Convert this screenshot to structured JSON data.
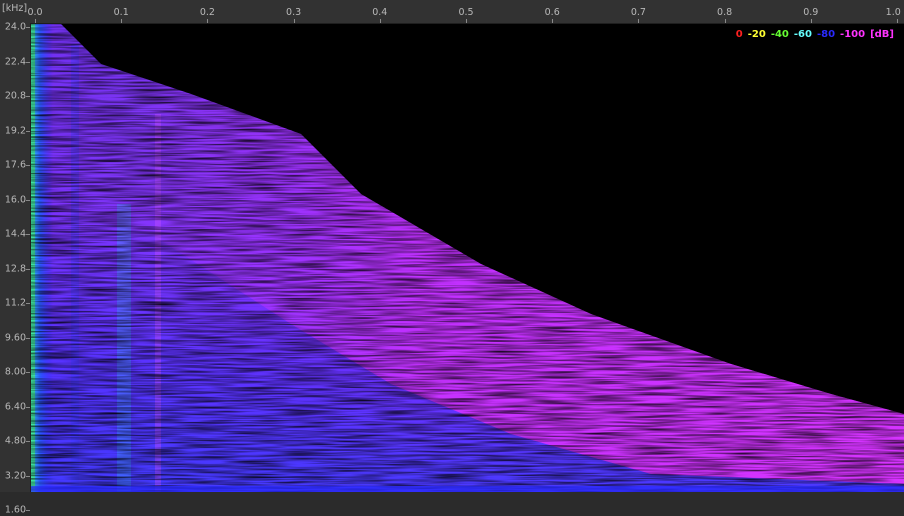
{
  "time_axis": {
    "ticks": [
      "0.0",
      "0.1",
      "0.2",
      "0.3",
      "0.4",
      "0.5",
      "0.6",
      "0.7",
      "0.8",
      "0.9",
      "1.0"
    ]
  },
  "freq_axis": {
    "unit": "[kHz]",
    "ticks": [
      "24.0",
      "22.4",
      "20.8",
      "19.2",
      "17.6",
      "16.0",
      "14.4",
      "12.8",
      "11.2",
      "9.60",
      "8.00",
      "6.40",
      "4.80",
      "3.20",
      "1.60"
    ]
  },
  "legend": {
    "entries": [
      {
        "label": "0",
        "color": "#ff2020"
      },
      {
        "label": "-20",
        "color": "#ffff33"
      },
      {
        "label": "-40",
        "color": "#66ff33"
      },
      {
        "label": "-60",
        "color": "#66ffff"
      },
      {
        "label": "-80",
        "color": "#2a2aff"
      },
      {
        "label": "-100",
        "color": "#ff33ff"
      },
      {
        "label": "[dB]",
        "color": "#ff33ff"
      }
    ]
  }
}
